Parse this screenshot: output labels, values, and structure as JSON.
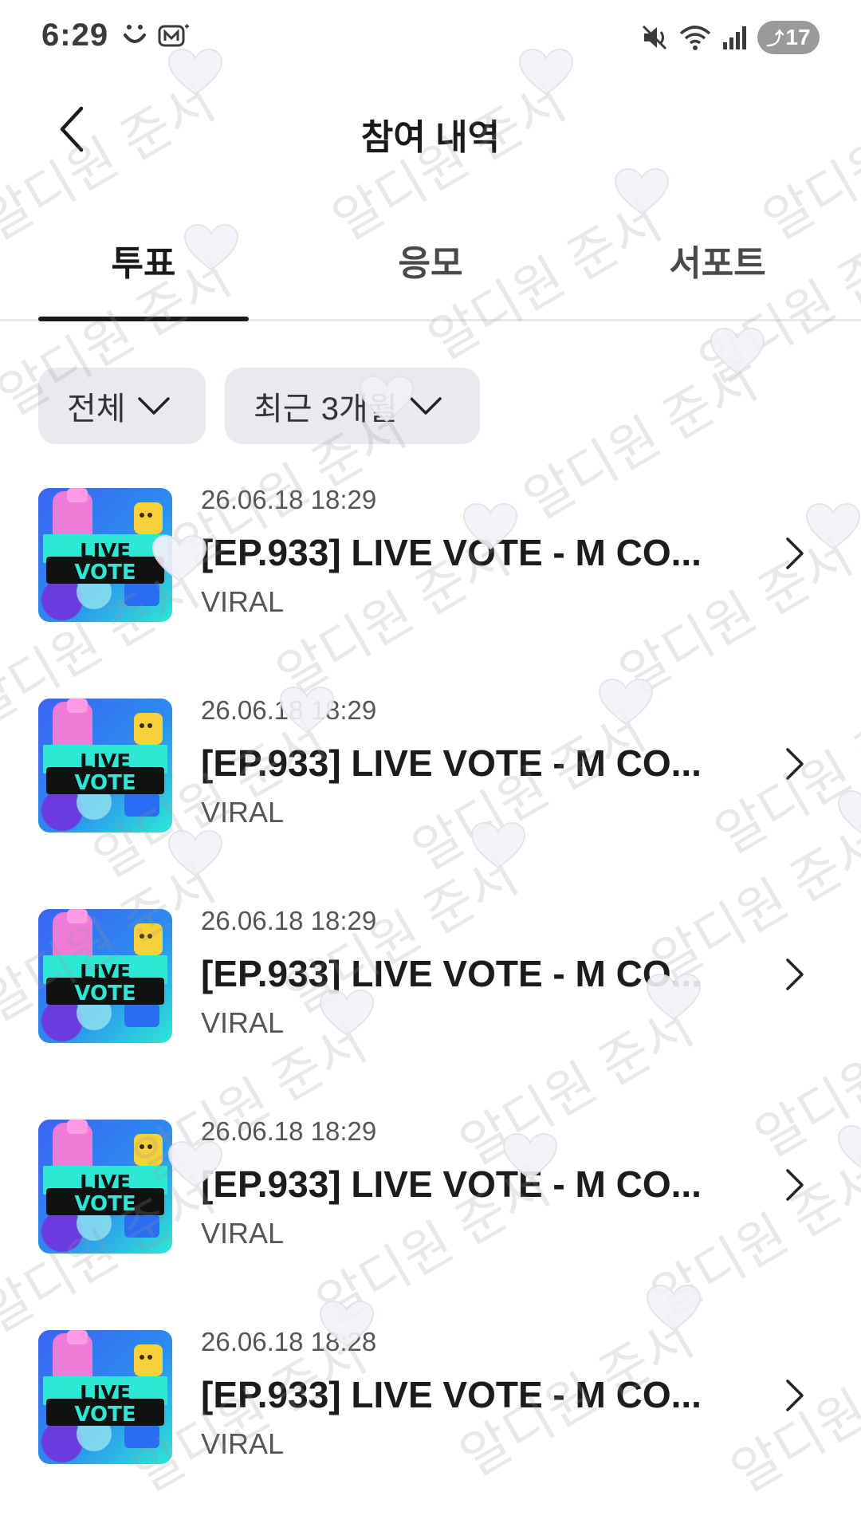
{
  "status_bar": {
    "time": "6:29",
    "battery": "17",
    "icons_left": [
      "smile-icon",
      "m-app-icon"
    ],
    "icons_right": [
      "mute-icon",
      "wifi-icon",
      "signal-icon"
    ]
  },
  "header": {
    "title": "참여 내역",
    "back_icon": "chevron-left-icon"
  },
  "tabs": [
    {
      "label": "투표",
      "active": true
    },
    {
      "label": "응모",
      "active": false
    },
    {
      "label": "서포트",
      "active": false
    }
  ],
  "filters": {
    "category": "전체",
    "period": "최근 3개월"
  },
  "items": [
    {
      "date": "26.06.18 18:29",
      "title": "[EP.933] LIVE VOTE - M CO...",
      "subtitle": "VIRAL"
    },
    {
      "date": "26.06.18 18:29",
      "title": "[EP.933] LIVE VOTE - M CO...",
      "subtitle": "VIRAL"
    },
    {
      "date": "26.06.18 18:29",
      "title": "[EP.933] LIVE VOTE - M CO...",
      "subtitle": "VIRAL"
    },
    {
      "date": "26.06.18 18:29",
      "title": "[EP.933] LIVE VOTE - M CO...",
      "subtitle": "VIRAL"
    },
    {
      "date": "26.06.18 18:28",
      "title": "[EP.933] LIVE VOTE - M CO...",
      "subtitle": "VIRAL"
    }
  ],
  "thumbnail": {
    "line1": "LIVE",
    "line2": "VOTE"
  },
  "watermark": {
    "text": "알디원 준서"
  },
  "colors": {
    "text_primary": "#1c1c1c",
    "text_secondary": "#555555",
    "chip_bg": "#e9eaef",
    "divider": "#e8e8ec",
    "thumb_cyan": "#2ee8d6",
    "thumb_blue": "#2a6cf2",
    "thumb_pink": "#f07ad8",
    "thumb_yellow": "#f7d13a"
  }
}
